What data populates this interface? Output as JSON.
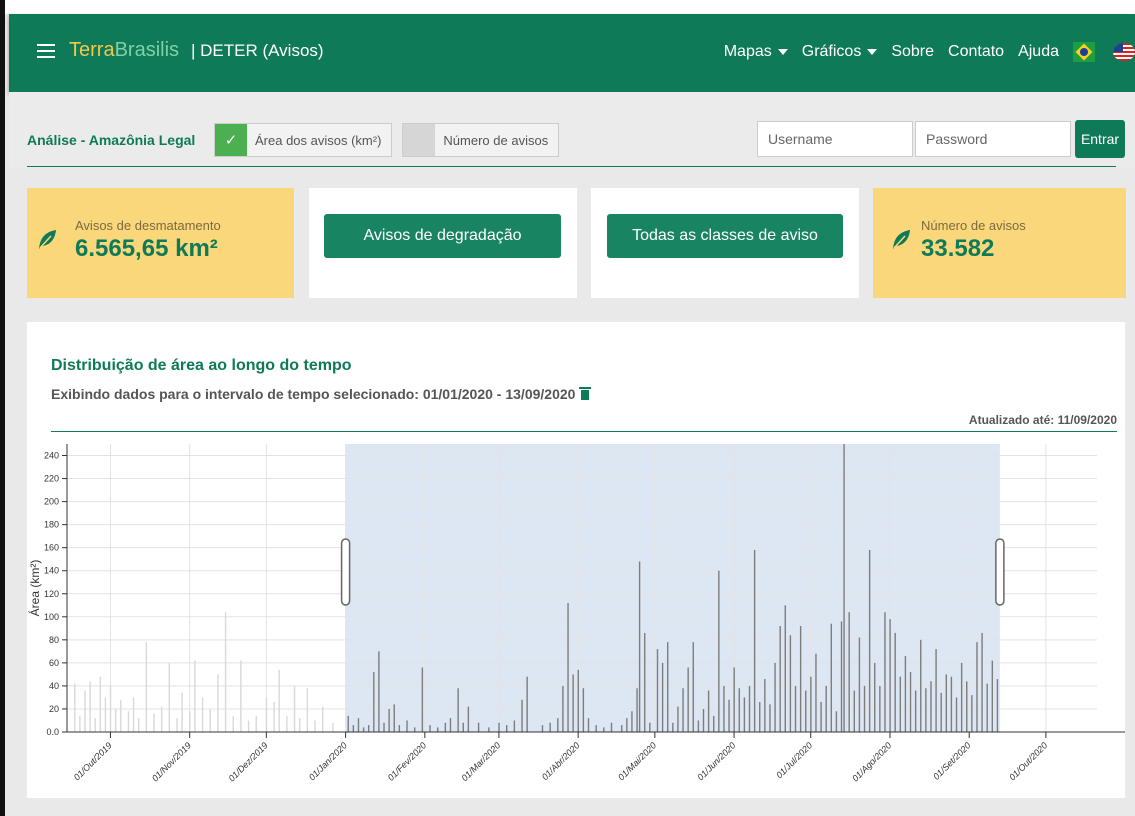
{
  "navbar": {
    "brand_part1": "Terra",
    "brand_part2": "Brasilis",
    "app_title": "| DETER (Avisos)",
    "links": [
      "Mapas",
      "Gráficos",
      "Sobre",
      "Contato",
      "Ajuda"
    ],
    "menu_icon": "hamburger-icon",
    "flags": [
      "brazil-flag-icon",
      "usa-flag-icon"
    ],
    "color": "#0e7a57"
  },
  "filters": {
    "section_label": "Análise - Amazônia Legal",
    "toggle_area_label": "Área dos avisos (km²)",
    "toggle_area_checked": true,
    "toggle_count_label": "Número de avisos",
    "toggle_count_checked": false,
    "username_placeholder": "Username",
    "password_placeholder": "Password",
    "login_button": "Entrar"
  },
  "cards": {
    "desmatamento_label": "Avisos de desmatamento",
    "desmatamento_value": "6.565,65 km²",
    "degradacao_button": "Avisos de degradação",
    "todas_button": "Todas as classes de aviso",
    "numero_label": "Número de avisos",
    "numero_value": "33.582",
    "highlight_color": "#fbd77b"
  },
  "chart_panel": {
    "title": "Distribuição de área ao longo do tempo",
    "subtitle": "Exibindo dados para o intervalo de tempo selecionado: 01/01/2020 - 13/09/2020",
    "updated": "Atualizado até: 11/09/2020"
  },
  "chart_data": {
    "type": "bar",
    "ylabel": "Área (km²)",
    "ylim": [
      0,
      250
    ],
    "yticks": [
      "0.0",
      "20",
      "40",
      "60",
      "80",
      "100",
      "120",
      "140",
      "160",
      "180",
      "200",
      "220",
      "240"
    ],
    "xticks": [
      "01/Out/2019",
      "01/Nov/2019",
      "01/Dez/2019",
      "01/Jan/2020",
      "01/Fev/2020",
      "01/Mar/2020",
      "01/Abr/2020",
      "01/Mai/2020",
      "01/Jun/2020",
      "01/Jul/2020",
      "01/Ago/2020",
      "01/Set/2020",
      "01/Out/2020"
    ],
    "x_start": "2019-09-14",
    "x_end": "2020-10-21",
    "selection": [
      "2020-01-01",
      "2020-09-13"
    ],
    "grid": true,
    "bar_color": "#7d7d7d",
    "out_of_selection_color": "#d9d9d9",
    "selection_color": "#dde6f3",
    "points": [
      [
        "2019-09-17",
        42
      ],
      [
        "2019-09-19",
        14
      ],
      [
        "2019-09-21",
        36
      ],
      [
        "2019-09-23",
        44
      ],
      [
        "2019-09-25",
        12
      ],
      [
        "2019-09-27",
        48
      ],
      [
        "2019-09-29",
        30
      ],
      [
        "2019-10-01",
        40
      ],
      [
        "2019-10-03",
        20
      ],
      [
        "2019-10-05",
        28
      ],
      [
        "2019-10-08",
        18
      ],
      [
        "2019-10-10",
        30
      ],
      [
        "2019-10-12",
        12
      ],
      [
        "2019-10-15",
        78
      ],
      [
        "2019-10-18",
        16
      ],
      [
        "2019-10-21",
        22
      ],
      [
        "2019-10-24",
        60
      ],
      [
        "2019-10-27",
        12
      ],
      [
        "2019-10-29",
        34
      ],
      [
        "2019-11-01",
        18
      ],
      [
        "2019-11-03",
        62
      ],
      [
        "2019-11-06",
        30
      ],
      [
        "2019-11-09",
        20
      ],
      [
        "2019-11-12",
        50
      ],
      [
        "2019-11-15",
        104
      ],
      [
        "2019-11-18",
        14
      ],
      [
        "2019-11-21",
        62
      ],
      [
        "2019-11-24",
        10
      ],
      [
        "2019-11-27",
        14
      ],
      [
        "2019-12-01",
        30
      ],
      [
        "2019-12-04",
        26
      ],
      [
        "2019-12-06",
        54
      ],
      [
        "2019-12-09",
        14
      ],
      [
        "2019-12-12",
        40
      ],
      [
        "2019-12-14",
        12
      ],
      [
        "2019-12-17",
        38
      ],
      [
        "2019-12-20",
        10
      ],
      [
        "2019-12-23",
        22
      ],
      [
        "2019-12-27",
        8
      ],
      [
        "2020-01-02",
        14
      ],
      [
        "2020-01-04",
        6
      ],
      [
        "2020-01-06",
        12
      ],
      [
        "2020-01-08",
        4
      ],
      [
        "2020-01-10",
        6
      ],
      [
        "2020-01-12",
        52
      ],
      [
        "2020-01-14",
        70
      ],
      [
        "2020-01-16",
        8
      ],
      [
        "2020-01-18",
        20
      ],
      [
        "2020-01-20",
        24
      ],
      [
        "2020-01-22",
        6
      ],
      [
        "2020-01-25",
        10
      ],
      [
        "2020-01-28",
        4
      ],
      [
        "2020-01-31",
        56
      ],
      [
        "2020-02-03",
        6
      ],
      [
        "2020-02-06",
        4
      ],
      [
        "2020-02-09",
        8
      ],
      [
        "2020-02-11",
        12
      ],
      [
        "2020-02-14",
        38
      ],
      [
        "2020-02-16",
        8
      ],
      [
        "2020-02-18",
        22
      ],
      [
        "2020-02-22",
        8
      ],
      [
        "2020-02-26",
        4
      ],
      [
        "2020-03-01",
        8
      ],
      [
        "2020-03-04",
        6
      ],
      [
        "2020-03-07",
        10
      ],
      [
        "2020-03-10",
        28
      ],
      [
        "2020-03-12",
        48
      ],
      [
        "2020-03-18",
        6
      ],
      [
        "2020-03-21",
        8
      ],
      [
        "2020-03-24",
        12
      ],
      [
        "2020-03-26",
        40
      ],
      [
        "2020-03-28",
        112
      ],
      [
        "2020-03-30",
        50
      ],
      [
        "2020-04-01",
        54
      ],
      [
        "2020-04-03",
        38
      ],
      [
        "2020-04-05",
        12
      ],
      [
        "2020-04-08",
        6
      ],
      [
        "2020-04-11",
        4
      ],
      [
        "2020-04-14",
        8
      ],
      [
        "2020-04-18",
        6
      ],
      [
        "2020-04-20",
        12
      ],
      [
        "2020-04-22",
        18
      ],
      [
        "2020-04-24",
        38
      ],
      [
        "2020-04-25",
        148
      ],
      [
        "2020-04-27",
        86
      ],
      [
        "2020-04-29",
        8
      ],
      [
        "2020-05-02",
        72
      ],
      [
        "2020-05-04",
        60
      ],
      [
        "2020-05-06",
        78
      ],
      [
        "2020-05-08",
        8
      ],
      [
        "2020-05-10",
        22
      ],
      [
        "2020-05-12",
        38
      ],
      [
        "2020-05-14",
        56
      ],
      [
        "2020-05-16",
        78
      ],
      [
        "2020-05-18",
        10
      ],
      [
        "2020-05-20",
        20
      ],
      [
        "2020-05-22",
        36
      ],
      [
        "2020-05-24",
        14
      ],
      [
        "2020-05-26",
        140
      ],
      [
        "2020-05-28",
        40
      ],
      [
        "2020-05-30",
        28
      ],
      [
        "2020-06-01",
        56
      ],
      [
        "2020-06-03",
        38
      ],
      [
        "2020-06-05",
        30
      ],
      [
        "2020-06-07",
        40
      ],
      [
        "2020-06-09",
        158
      ],
      [
        "2020-06-11",
        26
      ],
      [
        "2020-06-13",
        46
      ],
      [
        "2020-06-15",
        24
      ],
      [
        "2020-06-17",
        60
      ],
      [
        "2020-06-19",
        92
      ],
      [
        "2020-06-21",
        110
      ],
      [
        "2020-06-23",
        84
      ],
      [
        "2020-06-25",
        40
      ],
      [
        "2020-06-27",
        92
      ],
      [
        "2020-06-29",
        36
      ],
      [
        "2020-07-01",
        48
      ],
      [
        "2020-07-03",
        68
      ],
      [
        "2020-07-05",
        26
      ],
      [
        "2020-07-07",
        40
      ],
      [
        "2020-07-09",
        94
      ],
      [
        "2020-07-11",
        18
      ],
      [
        "2020-07-13",
        96
      ],
      [
        "2020-07-14",
        250
      ],
      [
        "2020-07-16",
        104
      ],
      [
        "2020-07-18",
        36
      ],
      [
        "2020-07-20",
        82
      ],
      [
        "2020-07-22",
        40
      ],
      [
        "2020-07-24",
        158
      ],
      [
        "2020-07-26",
        60
      ],
      [
        "2020-07-28",
        40
      ],
      [
        "2020-07-30",
        104
      ],
      [
        "2020-08-01",
        98
      ],
      [
        "2020-08-03",
        86
      ],
      [
        "2020-08-05",
        48
      ],
      [
        "2020-08-07",
        66
      ],
      [
        "2020-08-09",
        52
      ],
      [
        "2020-08-11",
        36
      ],
      [
        "2020-08-13",
        80
      ],
      [
        "2020-08-15",
        38
      ],
      [
        "2020-08-17",
        44
      ],
      [
        "2020-08-19",
        72
      ],
      [
        "2020-08-21",
        34
      ],
      [
        "2020-08-23",
        50
      ],
      [
        "2020-08-25",
        48
      ],
      [
        "2020-08-27",
        30
      ],
      [
        "2020-08-29",
        60
      ],
      [
        "2020-08-31",
        44
      ],
      [
        "2020-09-02",
        32
      ],
      [
        "2020-09-04",
        78
      ],
      [
        "2020-09-06",
        86
      ],
      [
        "2020-09-08",
        42
      ],
      [
        "2020-09-10",
        62
      ],
      [
        "2020-09-12",
        46
      ]
    ]
  }
}
